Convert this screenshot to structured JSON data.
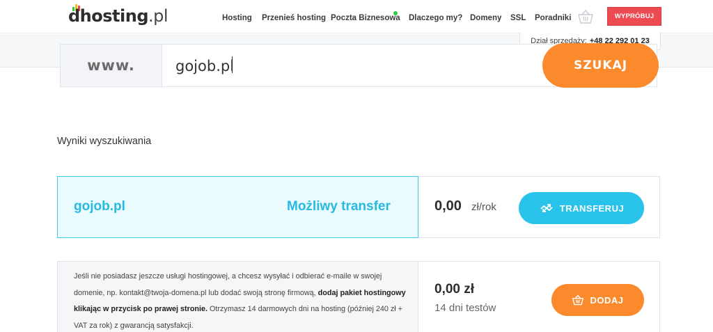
{
  "header": {
    "logo_main": "dhosting",
    "logo_tld": ".pl",
    "nav": [
      "Hosting",
      "Przenieś hosting",
      "Poczta Biznesowa",
      "Dlaczego my?",
      "Domeny",
      "SSL",
      "Poradniki"
    ],
    "try_label": "WYPRÓBUJ",
    "sales_label": "Dział sprzedaży:",
    "sales_phone": "+48 22 292 01 23",
    "cart_icon": "basket-icon",
    "new_badge_color": "#2ecc40"
  },
  "search": {
    "prefix": "www.",
    "value": "gojob.pl",
    "button_label": "SZUKAJ"
  },
  "results": {
    "title": "Wyniki wyszukiwania",
    "domain": {
      "name": "gojob.pl",
      "status": "Możliwy transfer",
      "price": "0,00",
      "unit": "zł/rok",
      "button_label": "TRANSFERUJ",
      "button_icon": "transfer-icon"
    },
    "hosting": {
      "text_1": "Jeśli nie posiadasz jeszcze usługi hostingowej, a chcesz wysyłać i odbierać e-maile w swojej domenie, np. kontakt@twoja-domena.pl lub dodać swoją stronę firmową, ",
      "text_bold": "dodaj pakiet hostingowy klikając w przycisk po prawej stronie.",
      "text_2": " Otrzymasz 14 darmowych dni na hosting (później 240 zł + VAT za rok) z gwarancją satysfakcji.",
      "price": "0,00 zł",
      "trial": "14 dni testów",
      "button_label": "DODAJ",
      "button_icon": "basket-icon"
    }
  },
  "colors": {
    "accent_orange": "#fb8a2d",
    "accent_cyan": "#28c2eb",
    "accent_red": "#ee4a52"
  }
}
